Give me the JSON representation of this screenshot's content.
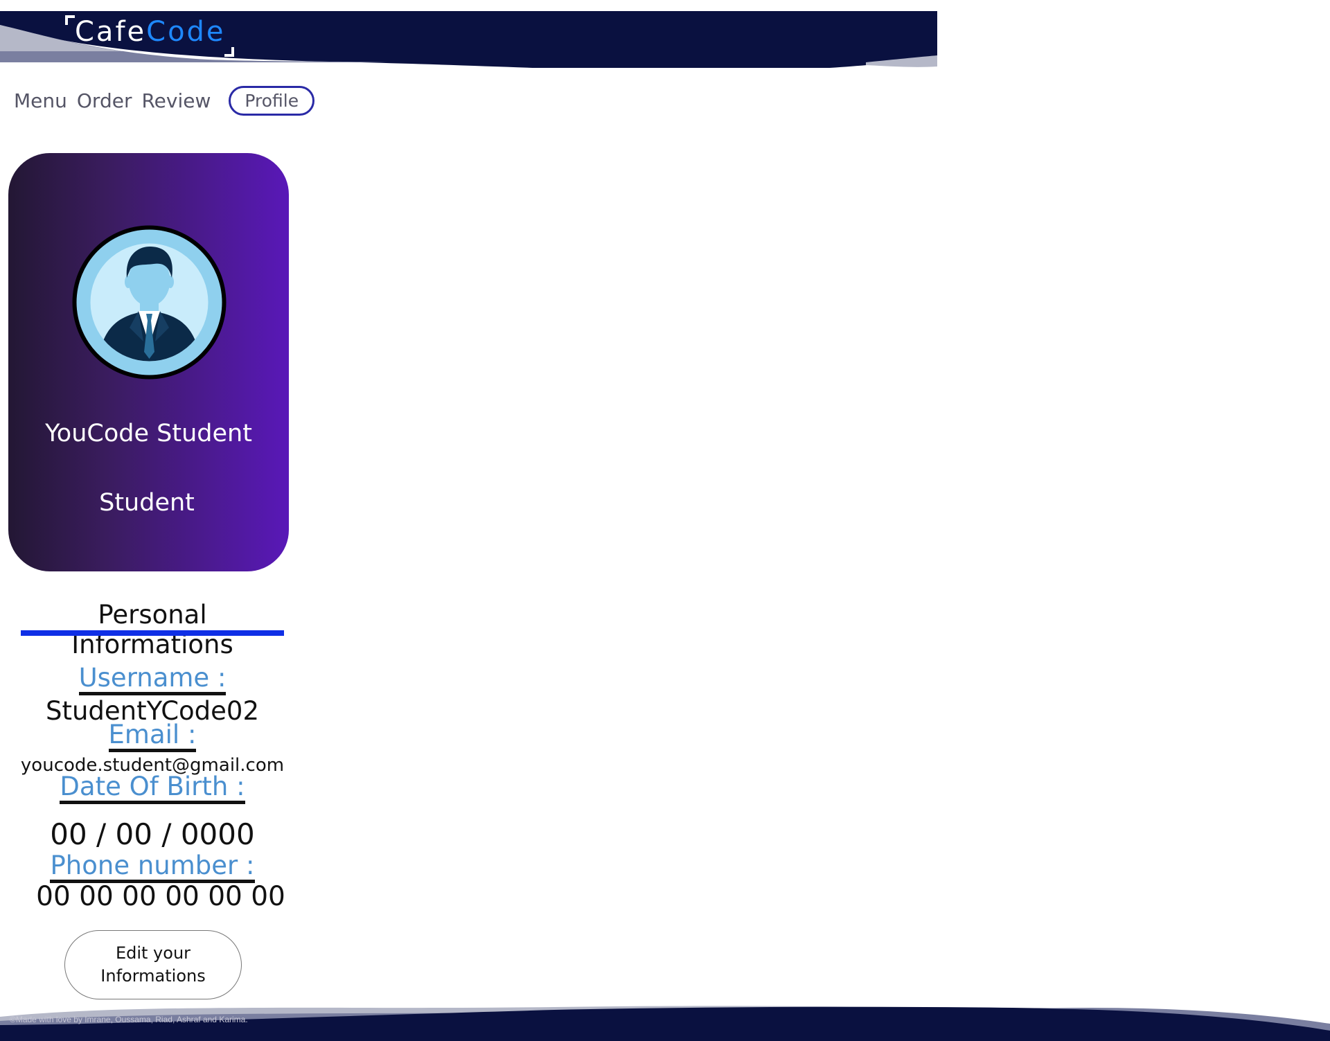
{
  "brand": {
    "part1": "Cafe",
    "part2": "Code"
  },
  "nav": {
    "items": [
      "Menu",
      "Order",
      "Review"
    ],
    "active": "Profile"
  },
  "profile": {
    "name": "YouCode Student",
    "role": "Student",
    "avatar_icon": "user-avatar-icon"
  },
  "info": {
    "title": "Personal Informations",
    "fields": [
      {
        "label": "Username :",
        "value": "StudentYCode02"
      },
      {
        "label": "Email :",
        "value": "youcode.student@gmail.com"
      },
      {
        "label": "Date Of Birth :",
        "value": "00 / 00 / 0000"
      },
      {
        "label": "Phone number :",
        "value": "00 00 00 00 00 00"
      }
    ],
    "edit_button": "Edit your Informations"
  },
  "footer": {
    "text": "©Made with love by Imrane, Oussama, Riad, Ashraf and Karima."
  },
  "colors": {
    "header_navy": "#0a1140",
    "accent_blue": "#1e88ff",
    "label_blue": "#4a8fcf",
    "underline_blue": "#0f2fe6",
    "card_purple": "#5918b8"
  }
}
